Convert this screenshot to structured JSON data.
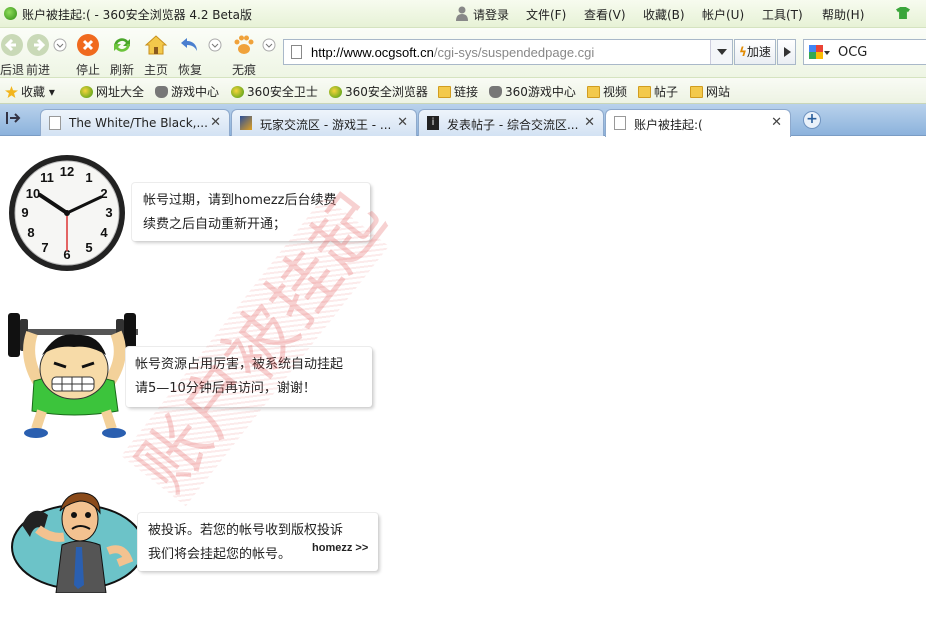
{
  "window": {
    "title": "账户被挂起:( - 360安全浏览器 4.2 Beta版",
    "login": "请登录",
    "menus": [
      "文件(F)",
      "查看(V)",
      "收藏(B)",
      "帐户(U)",
      "工具(T)",
      "帮助(H)"
    ]
  },
  "toolbar": {
    "back": "后退",
    "forward": "前进",
    "stop": "停止",
    "refresh": "刷新",
    "home": "主页",
    "restore": "恢复",
    "private": "无痕",
    "url_domain": "http://www.ocgsoft.cn",
    "url_path": "/cgi-sys/suspendedpage.cgi",
    "speed": "加速",
    "search_value": "OCG"
  },
  "favorites": [
    "收藏",
    "网址大全",
    "游戏中心",
    "360安全卫士",
    "360安全浏览器",
    "链接",
    "360游戏中心",
    "视频",
    "帖子",
    "网站"
  ],
  "tabs": [
    {
      "title": "The White/The Black,...",
      "active": false
    },
    {
      "title": "玩家交流区 - 游戏王 - ...",
      "active": false
    },
    {
      "title": "发表帖子 - 综合交流区...",
      "active": false
    },
    {
      "title": "账户被挂起:(",
      "active": true
    }
  ],
  "page": {
    "msg1": [
      "帐号过期，请到homezz后台续费",
      "续费之后自动重新开通；"
    ],
    "msg2": [
      "帐号资源占用厉害，被系统自动挂起",
      "请5—10分钟后再访问，谢谢！"
    ],
    "msg3": [
      "被投诉。若您的帐号收到版权投诉",
      "我们将会挂起您的帐号。"
    ],
    "more_link": "homezz >>",
    "stamp": "账户被挂起"
  },
  "colors": {
    "accent_green": "#3d9b14",
    "tab_blue": "#8cb2dc",
    "stamp_red": "#e25a5a"
  }
}
